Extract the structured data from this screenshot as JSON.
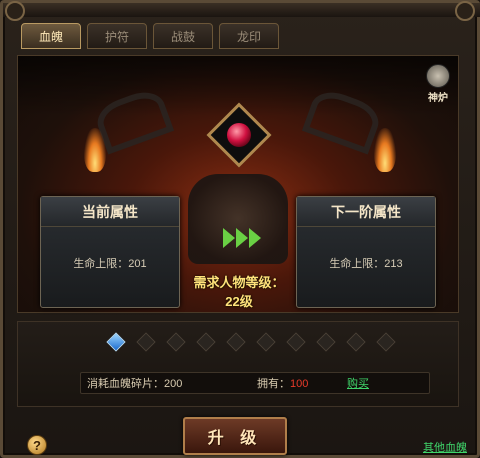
{
  "tabs": [
    {
      "label": "血魄",
      "active": true
    },
    {
      "label": "护符",
      "active": false
    },
    {
      "label": "战鼓",
      "active": false
    },
    {
      "label": "龙印",
      "active": false
    }
  ],
  "furnace": {
    "label": "神炉",
    "icon": "furnace-icon"
  },
  "current": {
    "title": "当前属性",
    "stat": "生命上限：201"
  },
  "next": {
    "title": "下一阶属性",
    "stat": "生命上限：213"
  },
  "requirement": {
    "line1": "需求人物等级：",
    "line2": "22级"
  },
  "slots": {
    "total": 10,
    "filled": 1
  },
  "cost": {
    "label": "消耗血魄碎片：200",
    "owned_label": "拥有：",
    "owned_value": "100",
    "buy": "购买"
  },
  "upgrade_button": "升 级",
  "help_icon": "?",
  "other_link": "其他血魄",
  "colors": {
    "accent_green": "#3fd56a",
    "owned_red": "#e83a2a",
    "gold_text": "#ffe27a"
  }
}
